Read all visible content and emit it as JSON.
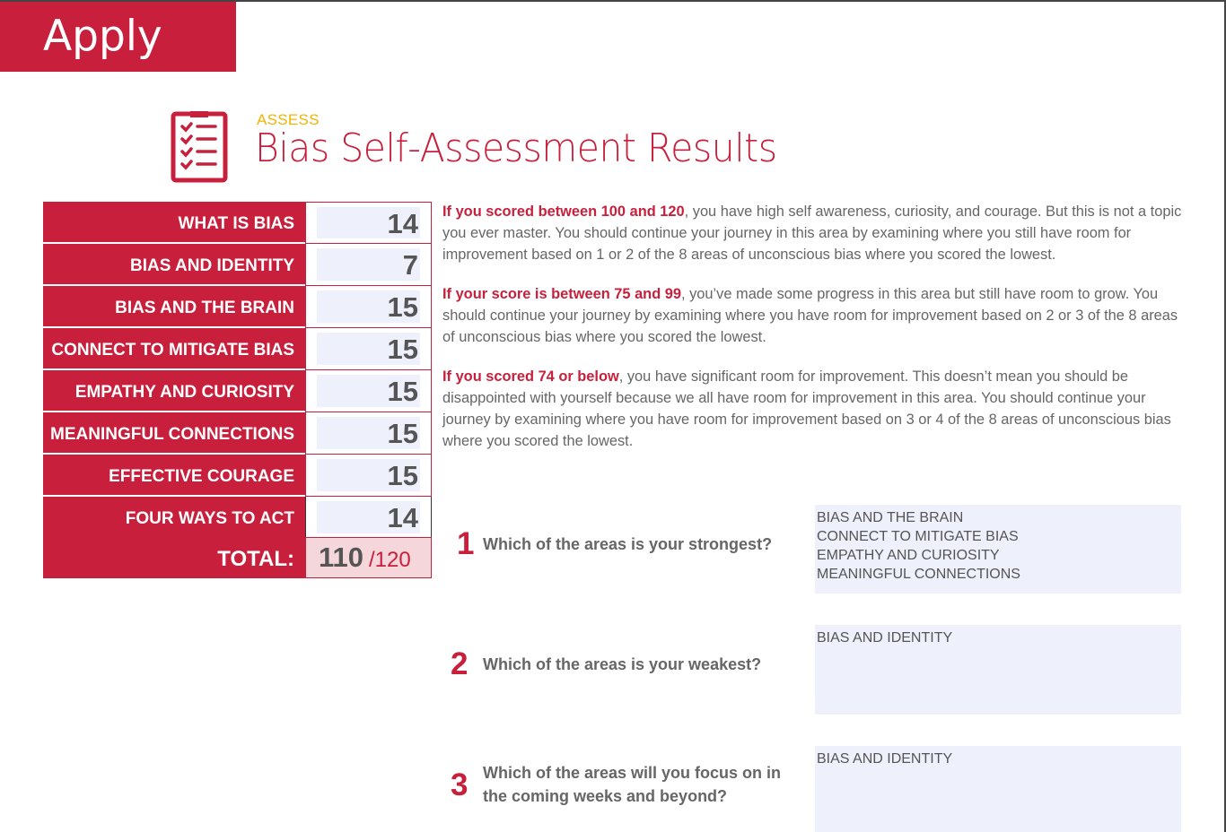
{
  "header": {
    "tab_label": "Apply"
  },
  "title_block": {
    "eyebrow": "ASSESS",
    "title": "Bias Self-Assessment Results",
    "icon": "checklist-clipboard-icon"
  },
  "scores": [
    {
      "label": "WHAT IS BIAS",
      "value": "14"
    },
    {
      "label": "BIAS AND IDENTITY",
      "value": "7"
    },
    {
      "label": "BIAS AND THE BRAIN",
      "value": "15"
    },
    {
      "label": "CONNECT TO MITIGATE BIAS",
      "value": "15"
    },
    {
      "label": "EMPATHY AND CURIOSITY",
      "value": "15"
    },
    {
      "label": "MEANINGFUL CONNECTIONS",
      "value": "15"
    },
    {
      "label": "EFFECTIVE COURAGE",
      "value": "15"
    },
    {
      "label": "FOUR WAYS TO ACT",
      "value": "14"
    }
  ],
  "total": {
    "label": "TOTAL:",
    "value": "110",
    "max": "/120"
  },
  "guidance": [
    {
      "lead": "If you scored between 100 and 120",
      "text": ", you have high self awareness, curiosity, and courage. But this is not a topic you ever master. You should continue your journey in this area by examining where you still have room for improvement based on 1 or 2 of the 8 areas of unconscious bias where you scored the lowest."
    },
    {
      "lead": "If your score is between 75 and 99",
      "text": ", you’ve made some progress in this area but still have room to grow. You should continue your journey by examining where you have room for improvement based on 2 or 3 of the 8 areas of unconscious bias where you scored the lowest."
    },
    {
      "lead": "If you scored 74 or below",
      "text": ", you have significant room for improvement. This doesn’t mean you should be disappointed with yourself because we all have room for improvement in this area. You should continue your journey by examining where you have room for improvement based on 3 or 4 of the 8 areas of unconscious bias where you scored the lowest."
    }
  ],
  "questions": [
    {
      "number": "1",
      "text": "Which of the areas is your strongest?",
      "answer": [
        "BIAS AND THE BRAIN",
        "CONNECT TO MITIGATE BIAS",
        "EMPATHY AND CURIOSITY",
        "MEANINGFUL CONNECTIONS"
      ]
    },
    {
      "number": "2",
      "text": "Which of the areas is your weakest?",
      "answer": [
        "BIAS AND IDENTITY"
      ]
    },
    {
      "number": "3",
      "text": "Which of the areas will you focus on in the coming weeks and beyond?",
      "answer": [
        "BIAS AND IDENTITY"
      ]
    }
  ],
  "colors": {
    "brand_red": "#c8203c",
    "accent_yellow": "#f0b400",
    "field_fill": "#eef0fb",
    "total_fill": "#f5d6da"
  }
}
